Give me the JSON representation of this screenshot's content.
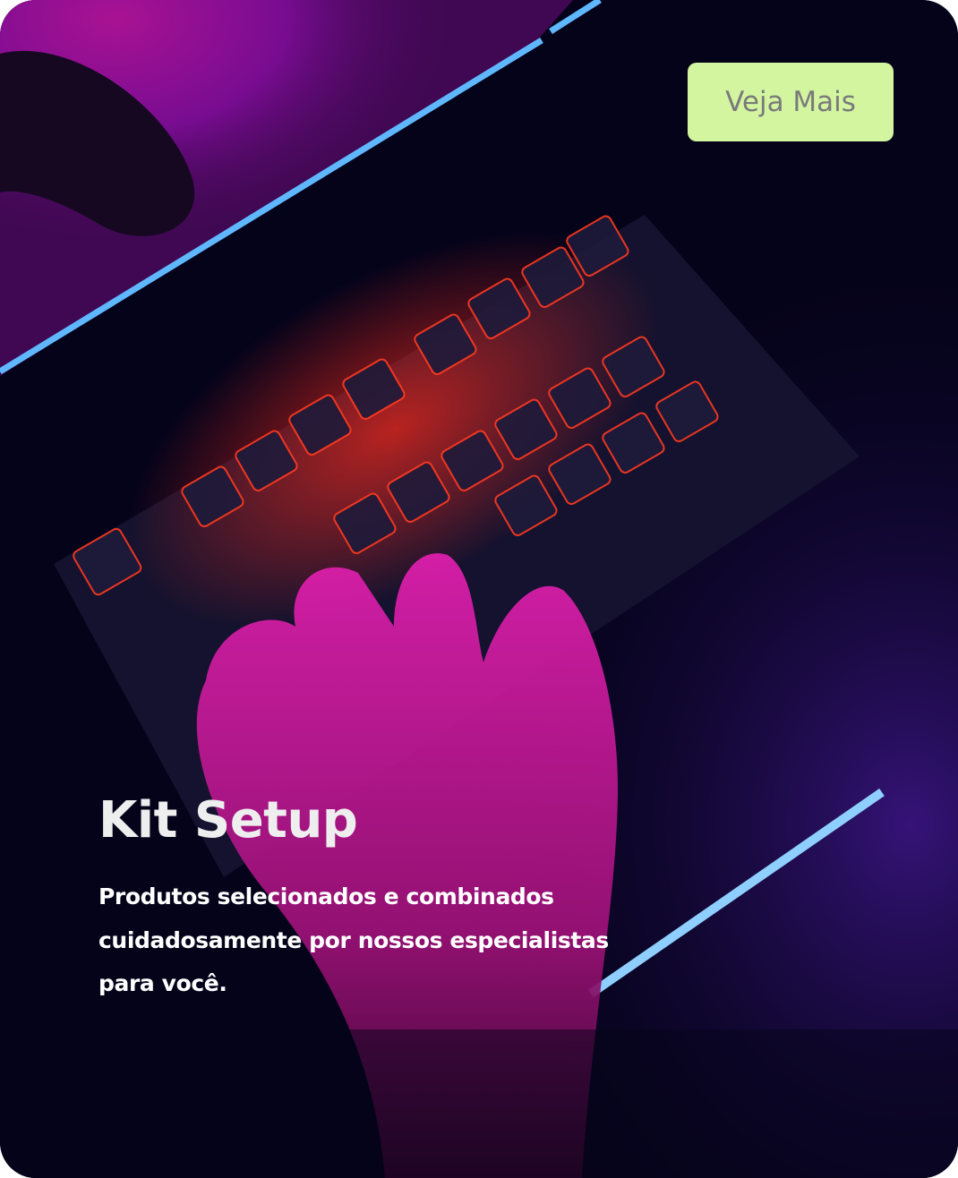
{
  "card": {
    "button_label": "Veja Mais",
    "title": "Kit Setup",
    "description": "Produtos selecionados e combinados cuidadosamente por nossos especialistas para você.",
    "colors": {
      "button_bg": "#d3f5a0",
      "button_text": "#7a7a7a",
      "background": "#05031a"
    }
  }
}
